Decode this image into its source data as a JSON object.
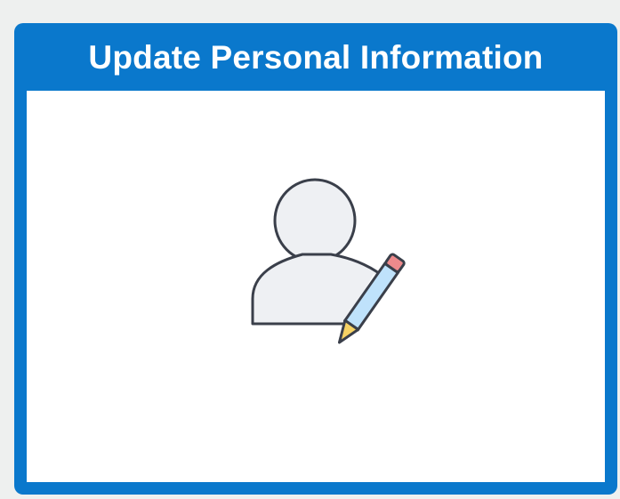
{
  "tile": {
    "title": "Update Personal Information",
    "icon": "person-edit-icon",
    "colors": {
      "header": "#0a78cc",
      "body": "#ffffff",
      "icon_fill": "#eef0f3",
      "icon_stroke": "#3a3f4a",
      "pencil_body": "#bfe2fb",
      "pencil_eraser": "#ee8a8c",
      "pencil_tip": "#f6d264"
    }
  }
}
